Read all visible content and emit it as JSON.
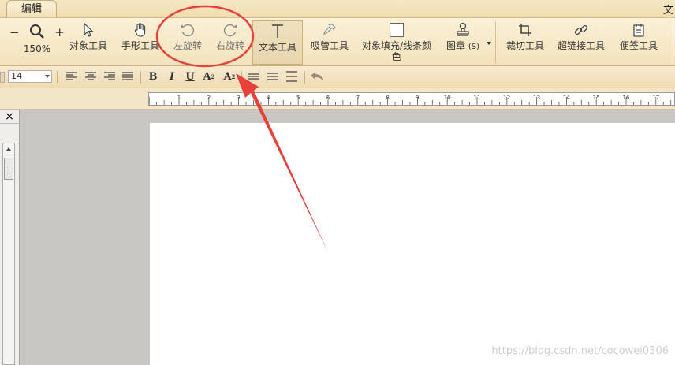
{
  "tabs": {
    "active": "编辑",
    "right_partial": "文"
  },
  "zoom": {
    "minus": "−",
    "plus": "+",
    "value": "150%"
  },
  "toolbar": {
    "object_tool": "对象工具",
    "hand_tool": "手形工具",
    "rotate_left": "左旋转",
    "rotate_right": "右旋转",
    "text_tool": "文本工具",
    "eyedropper_tool": "吸管工具",
    "fill_color": "对象填充/线条颜色",
    "stamp": "图章",
    "stamp_shortcut": "(S)",
    "crop_tool": "裁切工具",
    "link_tool": "超链接工具",
    "note_tool": "便签工具"
  },
  "format": {
    "font_size": "14",
    "bold": "B",
    "italic": "I",
    "underline": "U",
    "superscript_base": "A",
    "superscript_mark": "2",
    "subscript_base": "A",
    "subscript_mark": "2"
  },
  "ruler": {
    "labels": [
      "1",
      "2",
      "3",
      "4",
      "5",
      "6",
      "7",
      "8",
      "9",
      "10",
      "11",
      "12",
      "13",
      "14",
      "15",
      "16",
      "17"
    ]
  },
  "panel": {
    "close": "×"
  },
  "watermark": "https://blog.csdn.net/cocowei0306",
  "colors": {
    "annotation": "#e8403a",
    "ribbon": "#f6e6c2"
  }
}
